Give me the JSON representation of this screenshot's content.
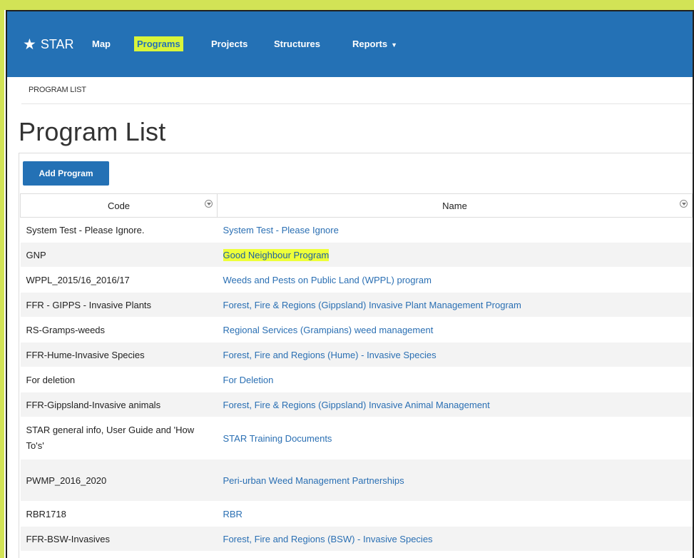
{
  "navbar": {
    "brand": "STAR",
    "items": [
      {
        "label": "Map"
      },
      {
        "label": "Programs"
      },
      {
        "label": "Projects"
      },
      {
        "label": "Structures"
      },
      {
        "label": "Reports"
      }
    ]
  },
  "breadcrumb": "PROGRAM LIST",
  "page_title": "Program List",
  "add_button": "Add Program",
  "table": {
    "headers": [
      "Code",
      "Name"
    ],
    "rows": [
      {
        "code": "System Test - Please Ignore.",
        "name": "System Test - Please Ignore"
      },
      {
        "code": "GNP",
        "name": "Good Neighbour Program"
      },
      {
        "code": "WPPL_2015/16_2016/17",
        "name": "Weeds and Pests on Public Land (WPPL) program"
      },
      {
        "code": "FFR - GIPPS - Invasive Plants",
        "name": "Forest, Fire & Regions (Gippsland) Invasive Plant Management Program"
      },
      {
        "code": "RS-Gramps-weeds",
        "name": "Regional Services (Grampians) weed management"
      },
      {
        "code": "FFR-Hume-Invasive Species",
        "name": "Forest, Fire and Regions (Hume) - Invasive Species"
      },
      {
        "code": "For deletion",
        "name": "For Deletion"
      },
      {
        "code": "FFR-Gippsland-Invasive animals",
        "name": "Forest, Fire & Regions (Gippsland) Invasive Animal Management"
      },
      {
        "code": "STAR general info, User Guide and 'How To's'",
        "name": "STAR Training Documents"
      },
      {
        "code": "PWMP_2016_2020",
        "name": "Peri-urban Weed Management Partnerships"
      },
      {
        "code": "RBR1718",
        "name": "RBR"
      },
      {
        "code": "FFR-BSW-Invasives",
        "name": "Forest, Fire and Regions (BSW) - Invasive Species"
      }
    ]
  },
  "colors": {
    "navbar": "#2471b5",
    "highlight": "#eeff3a",
    "link": "#2a6fb3"
  }
}
